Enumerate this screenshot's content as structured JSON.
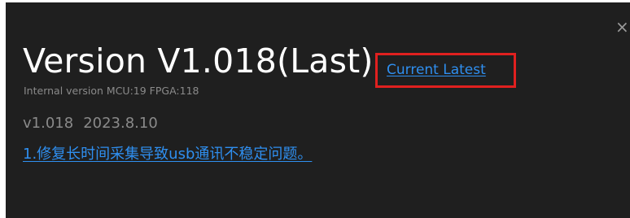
{
  "dialog": {
    "close_glyph": "×",
    "title": "Version V1.018(Last)",
    "latest_link": "Current Latest",
    "internal_version": "Internal version MCU:19 FPGA:118",
    "release": {
      "version": "v1.018",
      "date": "2023.8.10"
    },
    "change_notes": [
      "1.修复长时间采集导致usb通讯不稳定问题。"
    ]
  },
  "colors": {
    "background": "#1f1f1f",
    "title_text": "#ffffff",
    "muted_text": "#8a8a8a",
    "link": "#2f8ff0",
    "highlight_box": "#e0201f"
  },
  "icons": {
    "close": "close-icon"
  }
}
